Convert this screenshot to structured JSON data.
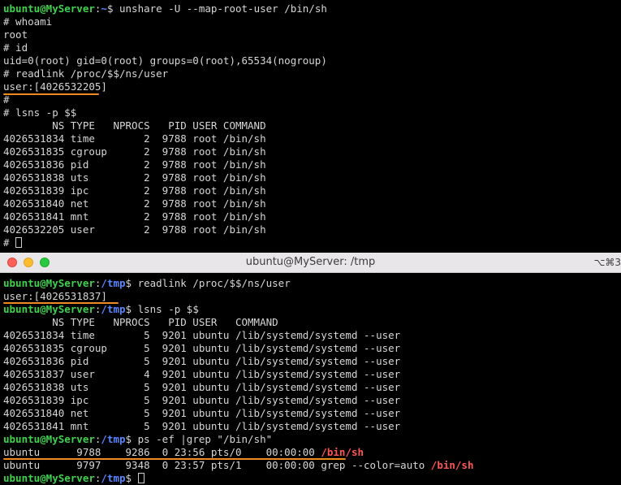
{
  "top_terminal": {
    "lines": [
      {
        "user": "ubuntu@MyServer",
        "path": "~",
        "text": "$ unshare -U --map-root-user /bin/sh"
      },
      {
        "text": "# whoami"
      },
      {
        "text": "root"
      },
      {
        "text": "# id"
      },
      {
        "text": "uid=0(root) gid=0(root) groups=0(root),65534(nogroup)"
      },
      {
        "text": "# readlink /proc/$$/ns/user"
      },
      {
        "text": "user:[4026532205]"
      },
      {
        "text": "#"
      },
      {
        "text": "# lsns -p $$"
      },
      {
        "text": "        NS TYPE   NPROCS   PID USER COMMAND"
      },
      {
        "text": "4026531834 time        2  9788 root /bin/sh"
      },
      {
        "text": "4026531835 cgroup      2  9788 root /bin/sh"
      },
      {
        "text": "4026531836 pid         2  9788 root /bin/sh"
      },
      {
        "text": "4026531838 uts         2  9788 root /bin/sh"
      },
      {
        "text": "4026531839 ipc         2  9788 root /bin/sh"
      },
      {
        "text": "4026531840 net         2  9788 root /bin/sh"
      },
      {
        "text": "4026531841 mnt         2  9788 root /bin/sh"
      },
      {
        "text": "4026532205 user        2  9788 root /bin/sh"
      },
      {
        "text": "# "
      }
    ]
  },
  "window": {
    "title": "ubuntu@MyServer: /tmp",
    "right_hint": "⌥⌘3"
  },
  "bottom_terminal": {
    "lines": [
      {
        "user": "ubuntu@MyServer",
        "path": "/tmp",
        "text": "$ readlink /proc/$$/ns/user"
      },
      {
        "text": "user:[4026531837]"
      },
      {
        "user": "ubuntu@MyServer",
        "path": "/tmp",
        "text": "$ lsns -p $$"
      },
      {
        "text": "        NS TYPE   NPROCS   PID USER   COMMAND"
      },
      {
        "text": "4026531834 time        5  9201 ubuntu /lib/systemd/systemd --user"
      },
      {
        "text": "4026531835 cgroup      5  9201 ubuntu /lib/systemd/systemd --user"
      },
      {
        "text": "4026531836 pid         5  9201 ubuntu /lib/systemd/systemd --user"
      },
      {
        "text": "4026531837 user        4  9201 ubuntu /lib/systemd/systemd --user"
      },
      {
        "text": "4026531838 uts         5  9201 ubuntu /lib/systemd/systemd --user"
      },
      {
        "text": "4026531839 ipc         5  9201 ubuntu /lib/systemd/systemd --user"
      },
      {
        "text": "4026531840 net         5  9201 ubuntu /lib/systemd/systemd --user"
      },
      {
        "text": "4026531841 mnt         5  9201 ubuntu /lib/systemd/systemd --user"
      },
      {
        "user": "ubuntu@MyServer",
        "path": "/tmp",
        "text": "$ ps -ef |grep \"/bin/sh\""
      },
      {
        "text": "ubuntu      9788    9286  0 23:56 pts/0    00:00:00 ",
        "red": "/bin/sh"
      },
      {
        "text": "ubuntu      9797    9348  0 23:57 pts/1    00:00:00 grep --color=auto ",
        "red": "/bin/sh"
      },
      {
        "user": "ubuntu@MyServer",
        "path": "/tmp",
        "text": "$ "
      }
    ]
  },
  "colors": {
    "background": "#000000",
    "text": "#d6d6d6",
    "prompt_user": "#3fd24d",
    "prompt_path": "#5b86ff",
    "match": "#ff5555",
    "annotation": "#ef8a1e",
    "titlebar": "#e8e6e8"
  }
}
